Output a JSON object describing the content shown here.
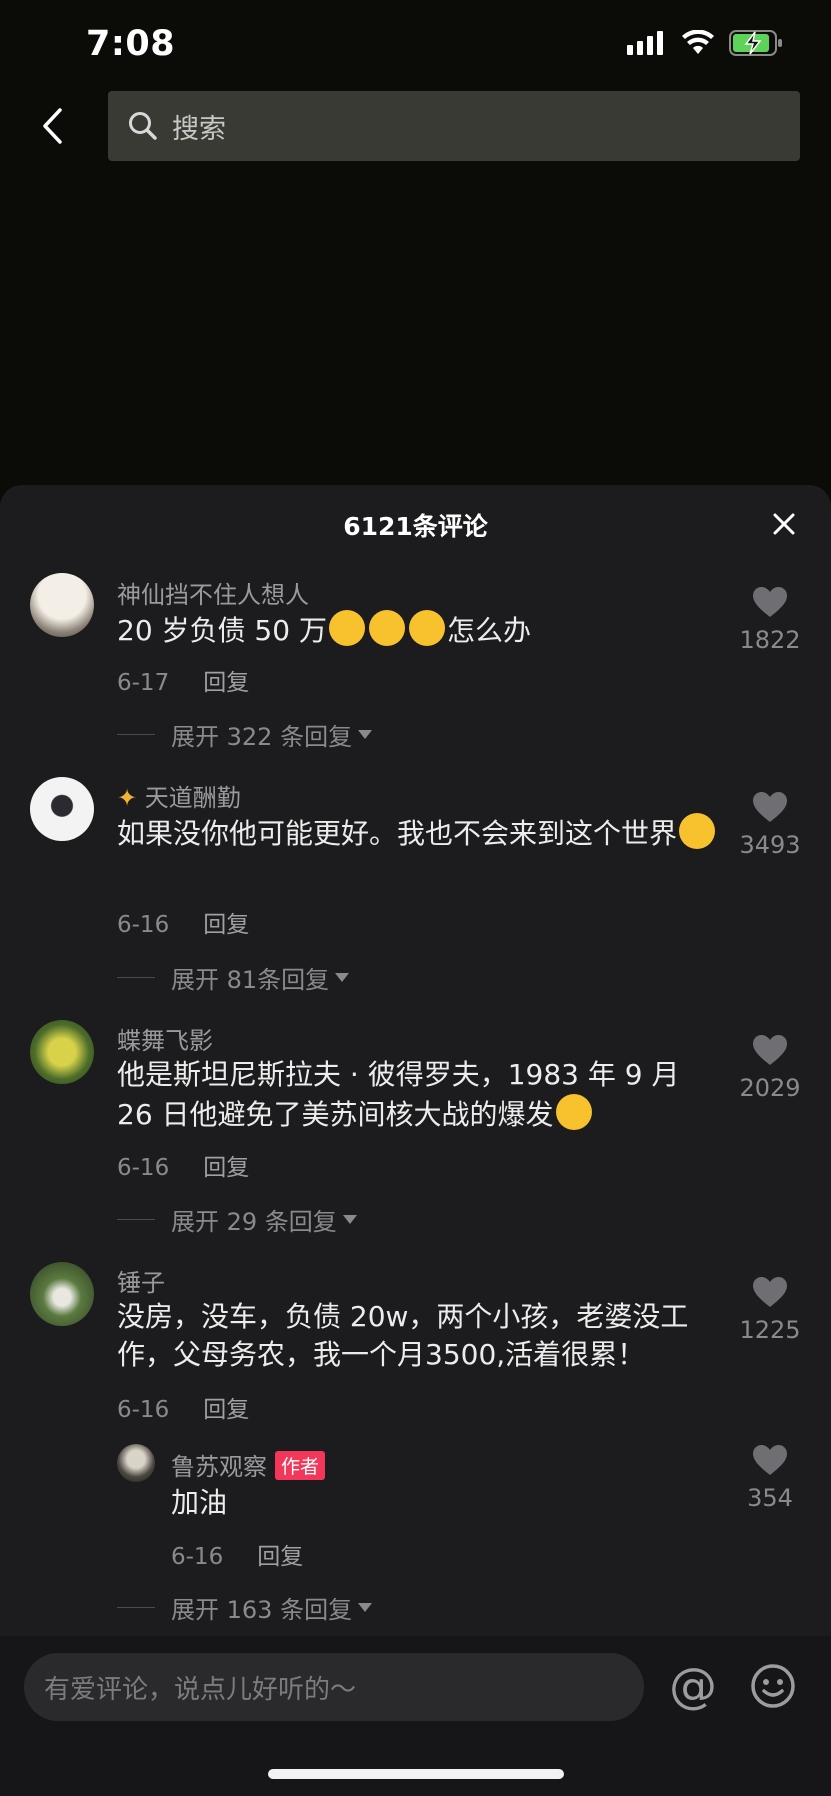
{
  "status": {
    "time": "7:08"
  },
  "search": {
    "placeholder": "搜索"
  },
  "panel": {
    "title": "6121条评论"
  },
  "comments": [
    {
      "name": "神仙挡不住人想人",
      "text_before": "20 岁负债 50 万",
      "emoji_count": 3,
      "text_after": "怎么办",
      "date": "6-17",
      "reply_label": "回复",
      "likes": "1822",
      "expand": "展开 322 条回复"
    },
    {
      "name": "天道酬勤",
      "text_before": "如果没你他可能更好。我也不会来到这个世界",
      "date": "6-16",
      "reply_label": "回复",
      "likes": "3493",
      "expand": "展开 81条回复"
    },
    {
      "name": "蝶舞飞影",
      "text_before": "他是斯坦尼斯拉夫 · 彼得罗夫，1983 年 9 月 26 日他避免了美苏间核大战的爆发",
      "date": "6-16",
      "reply_label": "回复",
      "likes": "2029",
      "expand": "展开 29 条回复"
    },
    {
      "name": "锤子",
      "text_before": "没房，没车，负债 20w，两个小孩，老婆没工作，父母务农，我一个月3500,活着很累！",
      "date": "6-16",
      "reply_label": "回复",
      "likes": "1225",
      "expand": "展开 163 条回复"
    }
  ],
  "reply": {
    "name": "鲁苏观察",
    "tag": "作者",
    "text": "加油",
    "date": "6-16",
    "reply_label": "回复",
    "likes": "354"
  },
  "bottom": {
    "input_placeholder": "有爱评论，说点儿好听的～",
    "at_symbol": "@"
  }
}
